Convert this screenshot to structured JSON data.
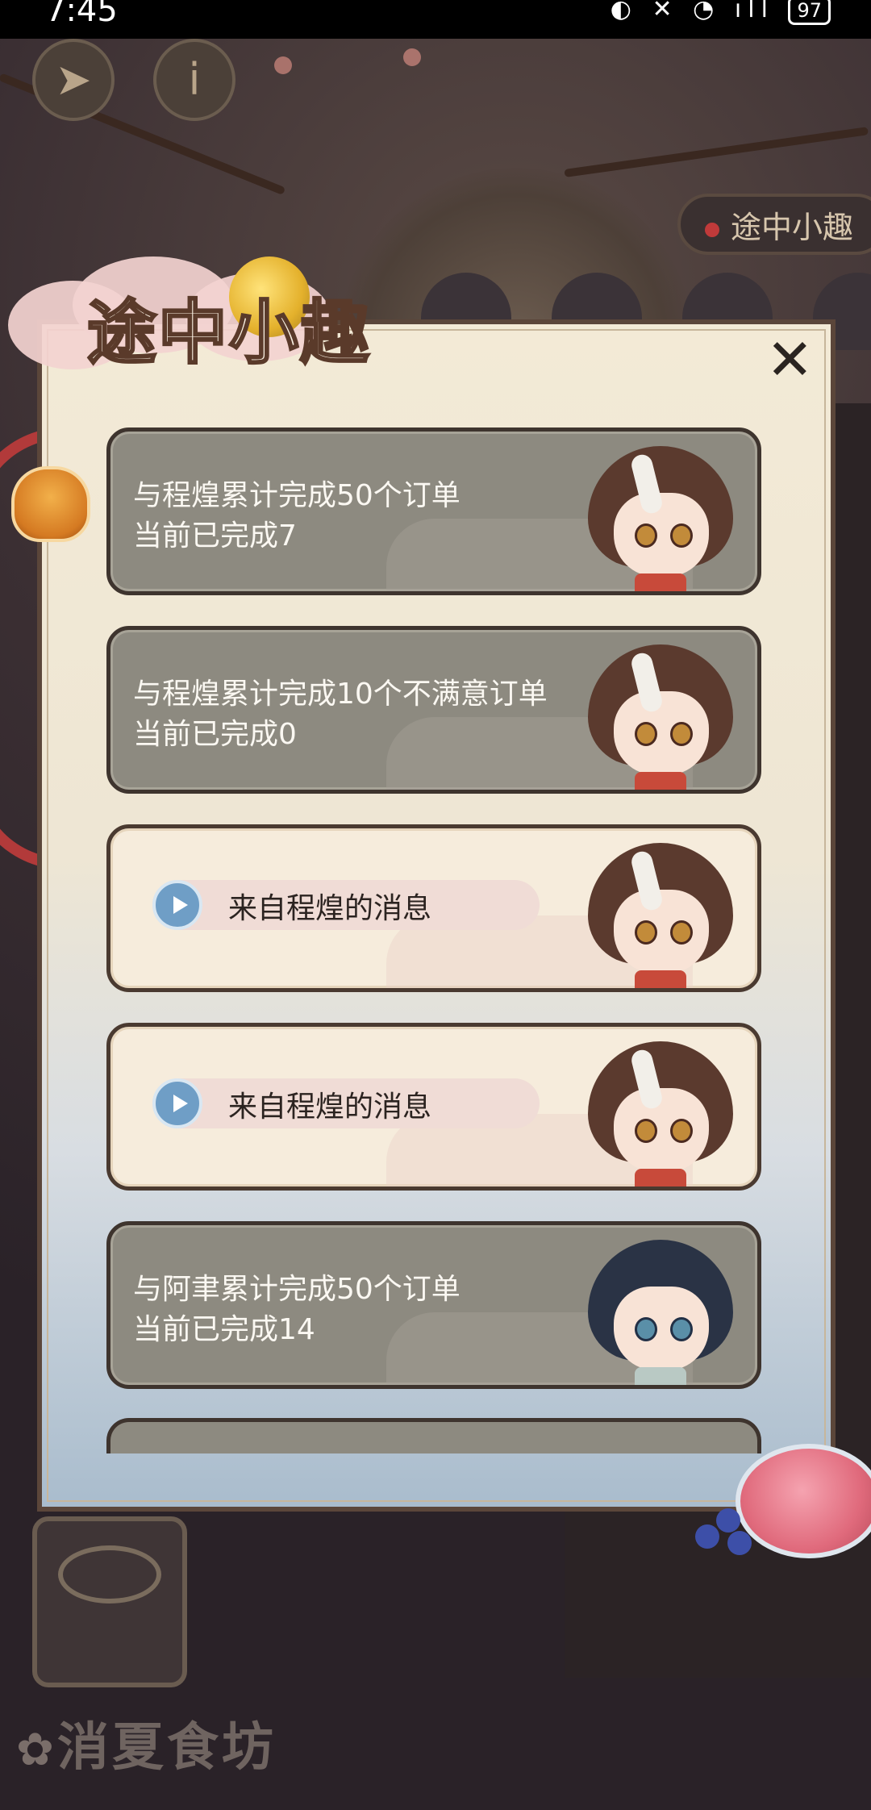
{
  "status_bar": {
    "time": "7:45",
    "icons": "◐ ✕ ◔ ıll",
    "battery": "97"
  },
  "background": {
    "back_button_icon": "back-arrow-icon",
    "info_button_icon": "info-icon",
    "side_tab_label": "途中小趣",
    "bottom_title": "消夏食坊"
  },
  "panel": {
    "title": "途中小趣",
    "close_label": "✕",
    "cards": [
      {
        "type": "achievement",
        "line1": "与程煌累计完成50个订单",
        "line2": "当前已完成7",
        "character": "程煌"
      },
      {
        "type": "achievement",
        "line1": "与程煌累计完成10个不满意订单",
        "line2": "当前已完成0",
        "character": "程煌"
      },
      {
        "type": "message",
        "text": "来自程煌的消息",
        "character": "程煌"
      },
      {
        "type": "message",
        "text": "来自程煌的消息",
        "character": "程煌"
      },
      {
        "type": "achievement",
        "line1": "与阿聿累计完成50个订单",
        "line2": "当前已完成14",
        "character": "阿聿"
      }
    ]
  },
  "colors": {
    "card_dark": "#8d8a80",
    "card_light": "#f6ecdc",
    "play_button": "#6f9ec6",
    "ribbon": "#b23a3a"
  }
}
